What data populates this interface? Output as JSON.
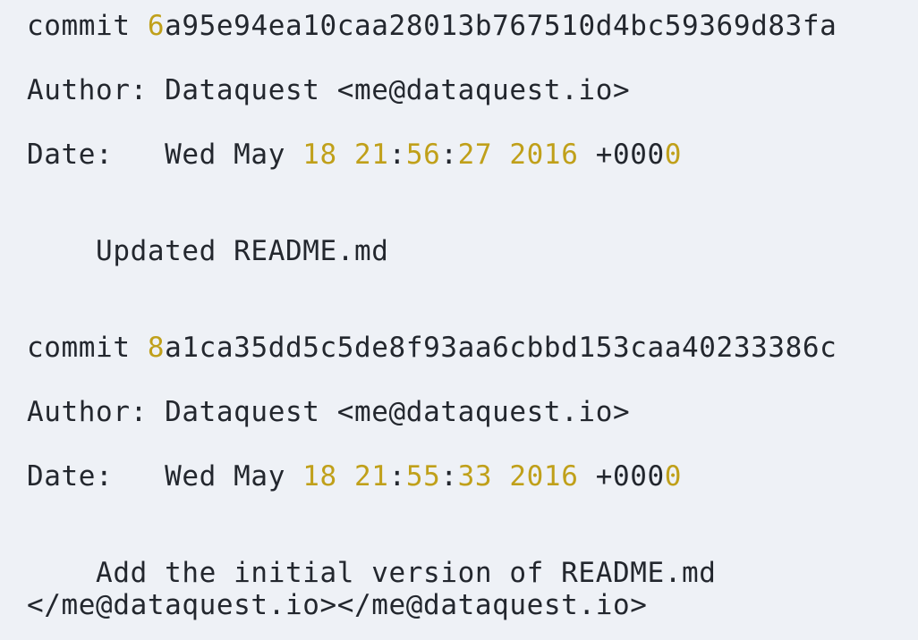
{
  "colors": {
    "background": "#eef1f6",
    "text": "#23272e",
    "number_highlight": "#c0a01a"
  },
  "commits": [
    {
      "commit_keyword": "commit ",
      "hash_first": "6",
      "hash_rest": "a95e94ea10caa28013b767510d4bc59369d83fa",
      "author_label": "Author: ",
      "author_value": "Dataquest <me@dataquest.io>",
      "date_label": "Date:   ",
      "date_weekday_month": "Wed May ",
      "date_day": "18",
      "date_hour": "21",
      "date_minute": "56",
      "date_second": "27",
      "date_year": "2016",
      "tz_prefix": "+000",
      "tz_last": "0",
      "message": "    Updated README.md"
    },
    {
      "commit_keyword": "commit ",
      "hash_first": "8",
      "hash_rest": "a1ca35dd5c5de8f93aa6cbbd153caa40233386c",
      "author_label": "Author: ",
      "author_value": "Dataquest <me@dataquest.io>",
      "date_label": "Date:   ",
      "date_weekday_month": "Wed May ",
      "date_day": "18",
      "date_hour": "21",
      "date_minute": "55",
      "date_second": "33",
      "date_year": "2016",
      "tz_prefix": "+000",
      "tz_last": "0",
      "message": "    Add the initial version of README.md"
    }
  ],
  "trailing_text": "</me@dataquest.io></me@dataquest.io>"
}
